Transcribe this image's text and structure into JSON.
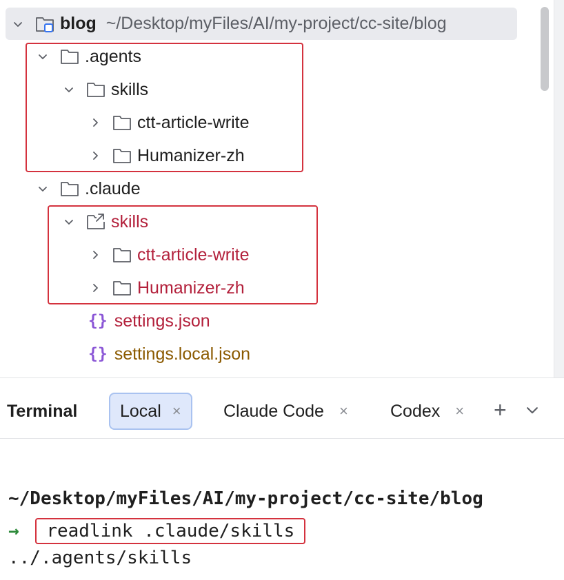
{
  "tree": {
    "root": {
      "name": "blog",
      "path": "~/Desktop/myFiles/AI/my-project/cc-site/blog"
    },
    "agents_folder": ".agents",
    "agents_skills": "skills",
    "agents_skill_1": "ctt-article-write",
    "agents_skill_2": "Humanizer-zh",
    "claude_folder": ".claude",
    "claude_skills": "skills",
    "claude_skill_1": "ctt-article-write",
    "claude_skill_2": "Humanizer-zh",
    "settings_json": "settings.json",
    "settings_local_json": "settings.local.json"
  },
  "terminal": {
    "title": "Terminal",
    "tabs": [
      {
        "label": "Local",
        "close": "×"
      },
      {
        "label": "Claude Code",
        "close": "×"
      },
      {
        "label": "Codex",
        "close": "×"
      }
    ],
    "add_label": "+",
    "cwd": "~/Desktop/myFiles/AI/my-project/cc-site/blog",
    "prompt_arrow": "→",
    "command": "readlink .claude/skills",
    "output": "../.agents/skills"
  },
  "colors": {
    "highlight_border": "#d4323e",
    "vcs_modified_red": "#b3203b",
    "vcs_brown": "#8b5a00",
    "json_icon_purple": "#8a55d6",
    "active_tab_bg": "#dfe8fb",
    "prompt_green": "#2d8a3a"
  },
  "icons": {
    "folder": "folder-icon",
    "module_folder": "module-folder-icon",
    "symlink_folder": "symlink-folder-icon",
    "json": "json-braces-icon",
    "chevron_down": "chevron-down-icon",
    "chevron_right": "chevron-right-icon"
  }
}
